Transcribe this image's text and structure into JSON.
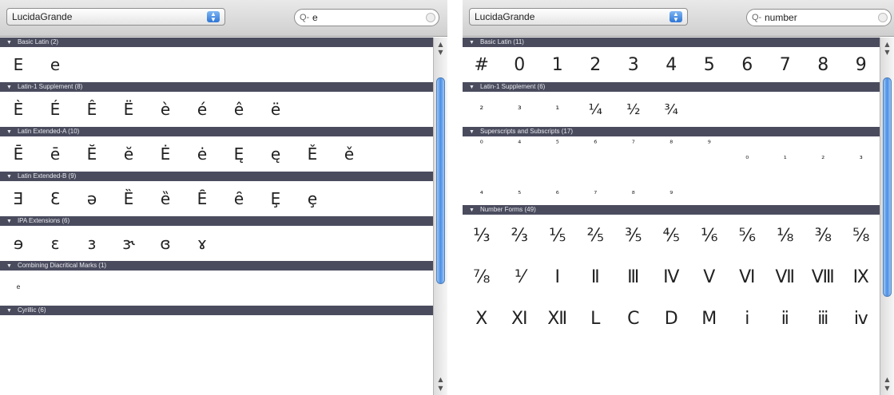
{
  "left": {
    "font_popup": "LucidaGrande",
    "search_value": "e",
    "sections": [
      {
        "title": "Basic Latin (2)",
        "glyphs": [
          "E",
          "e"
        ]
      },
      {
        "title": "Latin-1 Supplement (8)",
        "glyphs": [
          "È",
          "É",
          "Ê",
          "Ë",
          "è",
          "é",
          "ê",
          "ë"
        ]
      },
      {
        "title": "Latin Extended-A (10)",
        "glyphs": [
          "Ē",
          "ē",
          "Ĕ",
          "ĕ",
          "Ė",
          "ė",
          "Ę",
          "ę",
          "Ě",
          "ě"
        ]
      },
      {
        "title": "Latin Extended-B (9)",
        "glyphs": [
          "Ǝ",
          "Ɛ",
          "ə",
          "Ȅ",
          "ȅ",
          "Ȇ",
          "ȇ",
          "Ȩ",
          "ȩ"
        ]
      },
      {
        "title": "IPA Extensions (6)",
        "glyphs": [
          "ɘ",
          "ɛ",
          "ɜ",
          "ɝ",
          "ɞ",
          "ɤ"
        ]
      },
      {
        "title": "Combining Diacritical Marks (1)",
        "glyphs": [
          "ͤ"
        ]
      },
      {
        "title": "Cyrillic (6)",
        "glyphs": []
      }
    ]
  },
  "right": {
    "font_popup": "LucidaGrande",
    "search_value": "number",
    "sections": [
      {
        "title": "Basic Latin (11)",
        "glyphs": [
          "#",
          "0",
          "1",
          "2",
          "3",
          "4",
          "5",
          "6",
          "7",
          "8",
          "9"
        ]
      },
      {
        "title": "Latin-1 Supplement (6)",
        "glyphs": [
          "²",
          "³",
          "¹",
          "¼",
          "½",
          "¾"
        ]
      },
      {
        "title": "Superscripts and Subscripts (17)",
        "row1": [
          "⁰",
          "⁴",
          "⁵",
          "⁶",
          "⁷",
          "⁸",
          "⁹",
          "₀",
          "₁",
          "₂",
          "₃"
        ],
        "row2": [
          "₄",
          "₅",
          "₆",
          "₇",
          "₈",
          "₉"
        ]
      },
      {
        "title": "Number Forms (49)",
        "row1": [
          "⅓",
          "⅔",
          "⅕",
          "⅖",
          "⅗",
          "⅘",
          "⅙",
          "⅚",
          "⅛",
          "⅜",
          "⅝"
        ],
        "row2": [
          "⅞",
          "⅟",
          "Ⅰ",
          "Ⅱ",
          "Ⅲ",
          "Ⅳ",
          "Ⅴ",
          "Ⅵ",
          "Ⅶ",
          "Ⅷ",
          "Ⅸ"
        ],
        "row3": [
          "Ⅹ",
          "Ⅺ",
          "Ⅻ",
          "Ⅼ",
          "Ⅽ",
          "Ⅾ",
          "Ⅿ",
          "ⅰ",
          "ⅱ",
          "ⅲ",
          "ⅳ"
        ]
      }
    ]
  },
  "icons": {
    "disclosure": "▼",
    "popup_arrows_up": "▲",
    "popup_arrows_down": "▼",
    "search": "Q-",
    "scroll_up": "▲",
    "scroll_down": "▼"
  }
}
